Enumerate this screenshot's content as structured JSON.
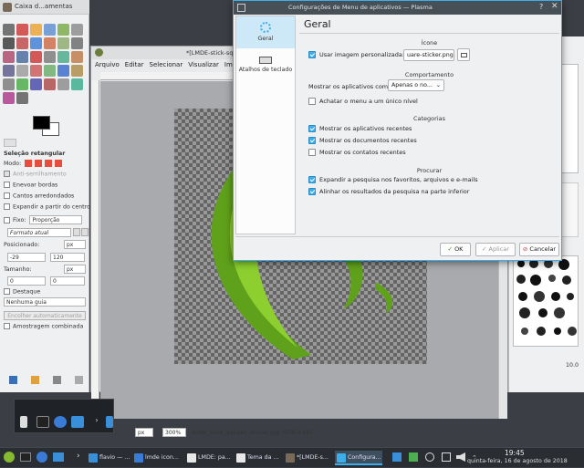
{
  "toolbox": {
    "title": "Caixa d...amentas",
    "selection_title": "Seleção retangular",
    "mode_label": "Modo:",
    "antialias": "Anti-serrilhamento",
    "feather": "Enevoar bordas",
    "rounded": "Cantos arredondados",
    "expand_center": "Expandir a partir do centro",
    "fixed_label": "Fixo:",
    "fixed_value": "Proporção",
    "ratio_value": "Formato atual",
    "position_label": "Posicionado:",
    "position_unit": "px",
    "pos_x": "-29",
    "pos_y": "120",
    "size_label": "Tamanho:",
    "size_unit": "px",
    "size_w": "0",
    "size_h": "0",
    "highlight": "Destaque",
    "guides": "Nenhuma guia",
    "auto_shrink": "Encolher automaticamente",
    "sample_merged": "Amostragem combinada"
  },
  "image_window": {
    "title": "*[LMDE-stick-sq...",
    "menu": [
      "Arquivo",
      "Editar",
      "Selecionar",
      "Visualizar",
      "Ima"
    ],
    "unit": "px",
    "zoom": "300%",
    "status": "lmde_stick_square_sticker.jpg (956,0 kB)"
  },
  "dialog": {
    "title": "Configurações de Menu de aplicativos — Plasma",
    "side_items": [
      {
        "label": "Geral",
        "icon": "gear-icon"
      },
      {
        "label": "Atalhos de teclado",
        "icon": "keyboard-icon"
      }
    ],
    "heading": "Geral",
    "section_icon": "Ícone",
    "use_custom_image": "Usar imagem personalizada:",
    "custom_image_value": "uare-sticker.png",
    "section_behavior": "Comportamento",
    "show_apps_as_label": "Mostrar os aplicativos como:",
    "show_apps_as_value": "Apenas o no...",
    "flatten_menu": "Achatar o menu a um único nível",
    "section_categories": "Categorias",
    "show_recent_apps": "Mostrar os aplicativos recentes",
    "show_recent_docs": "Mostrar os documentos recentes",
    "show_recent_contacts": "Mostrar os contatos recentes",
    "section_search": "Procurar",
    "expand_search": "Expandir a pesquisa nos favoritos, arquivos e e-mails",
    "align_search_results": "Alinhar os resultados da pesquisa na parte inferior",
    "ok": "OK",
    "apply": "Aplicar",
    "cancel": "Cancelar"
  },
  "right_panel": {
    "zoom_value": "10.0"
  },
  "taskbar": {
    "items": [
      {
        "label": "flavio — ...",
        "icon": "folder-icon"
      },
      {
        "label": "lmde icon...",
        "icon": "chrome-icon"
      },
      {
        "label": "LMDE: pa...",
        "icon": "document-icon"
      },
      {
        "label": "Tema da ...",
        "icon": "document-icon"
      },
      {
        "label": "*[LMDE-s...",
        "icon": "gimp-icon"
      },
      {
        "label": "Configura...",
        "icon": "settings-icon"
      }
    ],
    "time": "19:45",
    "date": "quinta-feira, 16 de agosto de 2018"
  }
}
